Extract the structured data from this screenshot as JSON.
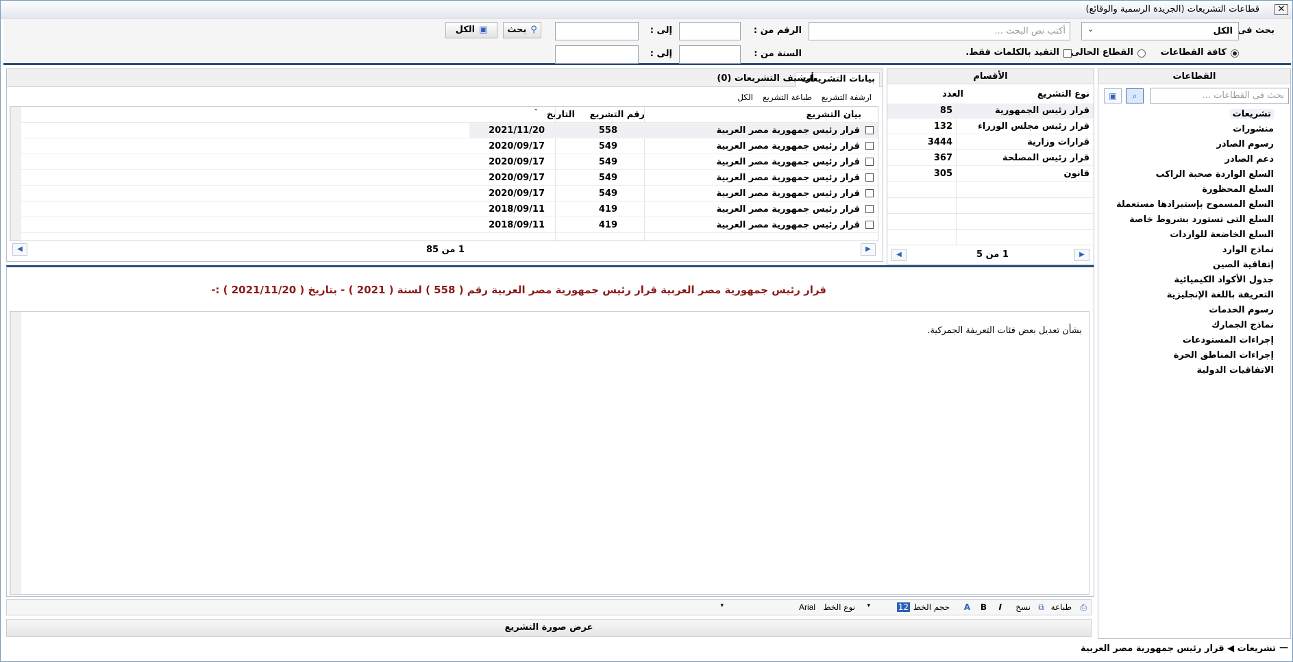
{
  "window": {
    "title": "قطاعات التشريعات (الجريدة الرسمية والوقائع)",
    "close_glyph": "✕"
  },
  "search": {
    "search_in_label": "بحث فى :",
    "search_in_value": "الكل",
    "text_placeholder": "أكتب نص البحث ...",
    "number_from_label": "الرقم من :",
    "to_label": "إلى :",
    "year_from_label": "السنة من :",
    "search_button": "بحث",
    "all_button": "الكل",
    "radio_all_sectors": "كافة القطاعات",
    "radio_current_sector": "القطاع الحالى",
    "exact_words_label": "التقيد بالكلمات فقط."
  },
  "sectors": {
    "header": "القطاعات",
    "search_placeholder": "بحث فى القطاعات ...",
    "items": [
      "تشريعات",
      "منشورات",
      "رسوم الصادر",
      "دعم الصادر",
      "السلع الواردة صحبة الراكب",
      "السلع المحظورة",
      "السلع المسموح بإستيرادها مستعملة",
      "السلع التى تستورد بشروط خاصة",
      "السلع الخاضعة للواردات",
      "نماذج الوارد",
      "إتفاقية الصين",
      "جدول الأكواد الكيميائية",
      "التعريفة باللغة الإنجليزية",
      "رسوم الخدمات",
      "نماذج الجمارك",
      "إجراءات المستودعات",
      "إجراءات المناطق الحرة",
      "الاتفاقيات الدولية"
    ]
  },
  "sections": {
    "header": "الأقسام",
    "col_type": "نوع التشريع",
    "col_count": "العدد",
    "rows": [
      {
        "type": "قرار رئيس الجمهورية",
        "count": "85"
      },
      {
        "type": "قرار رئيس مجلس الوزراء",
        "count": "132"
      },
      {
        "type": "قرارات وزارية",
        "count": "3444"
      },
      {
        "type": "قرار رئيس المصلحة",
        "count": "367"
      },
      {
        "type": "قانون",
        "count": "305"
      }
    ],
    "pager": "1 من 5"
  },
  "legislation": {
    "tab_data": "بيانات التشريعات",
    "tab_archive": "أرشيف التشريعات (0)",
    "link_archive": "ارشفة التشريع",
    "link_print": "طباعة التشريع",
    "link_all": "الكل",
    "col_statement": "بيان التشريع",
    "col_number": "رقم التشريع",
    "col_date": "التاريخ",
    "rows": [
      {
        "statement": "قرار رئيس جمهورية مصر العربية",
        "number": "558",
        "date": "2021/11/20"
      },
      {
        "statement": "قرار رئيس جمهورية مصر العربية",
        "number": "549",
        "date": "2020/09/17"
      },
      {
        "statement": "قرار رئيس جمهورية مصر العربية",
        "number": "549",
        "date": "2020/09/17"
      },
      {
        "statement": "قرار رئيس جمهورية مصر العربية",
        "number": "549",
        "date": "2020/09/17"
      },
      {
        "statement": "قرار رئيس جمهورية مصر العربية",
        "number": "549",
        "date": "2020/09/17"
      },
      {
        "statement": "قرار رئيس جمهورية مصر العربية",
        "number": "419",
        "date": "2018/09/11"
      },
      {
        "statement": "قرار رئيس جمهورية مصر العربية",
        "number": "419",
        "date": "2018/09/11"
      }
    ],
    "pager": "1 من 85"
  },
  "detail": {
    "heading": "قرار رئيس جمهورية مصر العربية قرار رئيس جمهورية مصر العربية رقم  ( 558 )  لسنة  ( 2021 )  - بتاريخ  ( 2021/11/20 )  :-",
    "body": "بشأن تعديل بعض فئات التعريفة الجمركية."
  },
  "format_bar": {
    "print": "طباعة",
    "copy": "نسخ",
    "italic": "I",
    "bold": "B",
    "font_size_label": "حجم الخط",
    "font_size_value": "12",
    "font_type_label": "نوع الخط",
    "font_type_value": "Arial"
  },
  "show_image_button": "عرض صورة التشريع",
  "status": "تشريعات ◀ قرار رئيس جمهورية مصر العربية"
}
